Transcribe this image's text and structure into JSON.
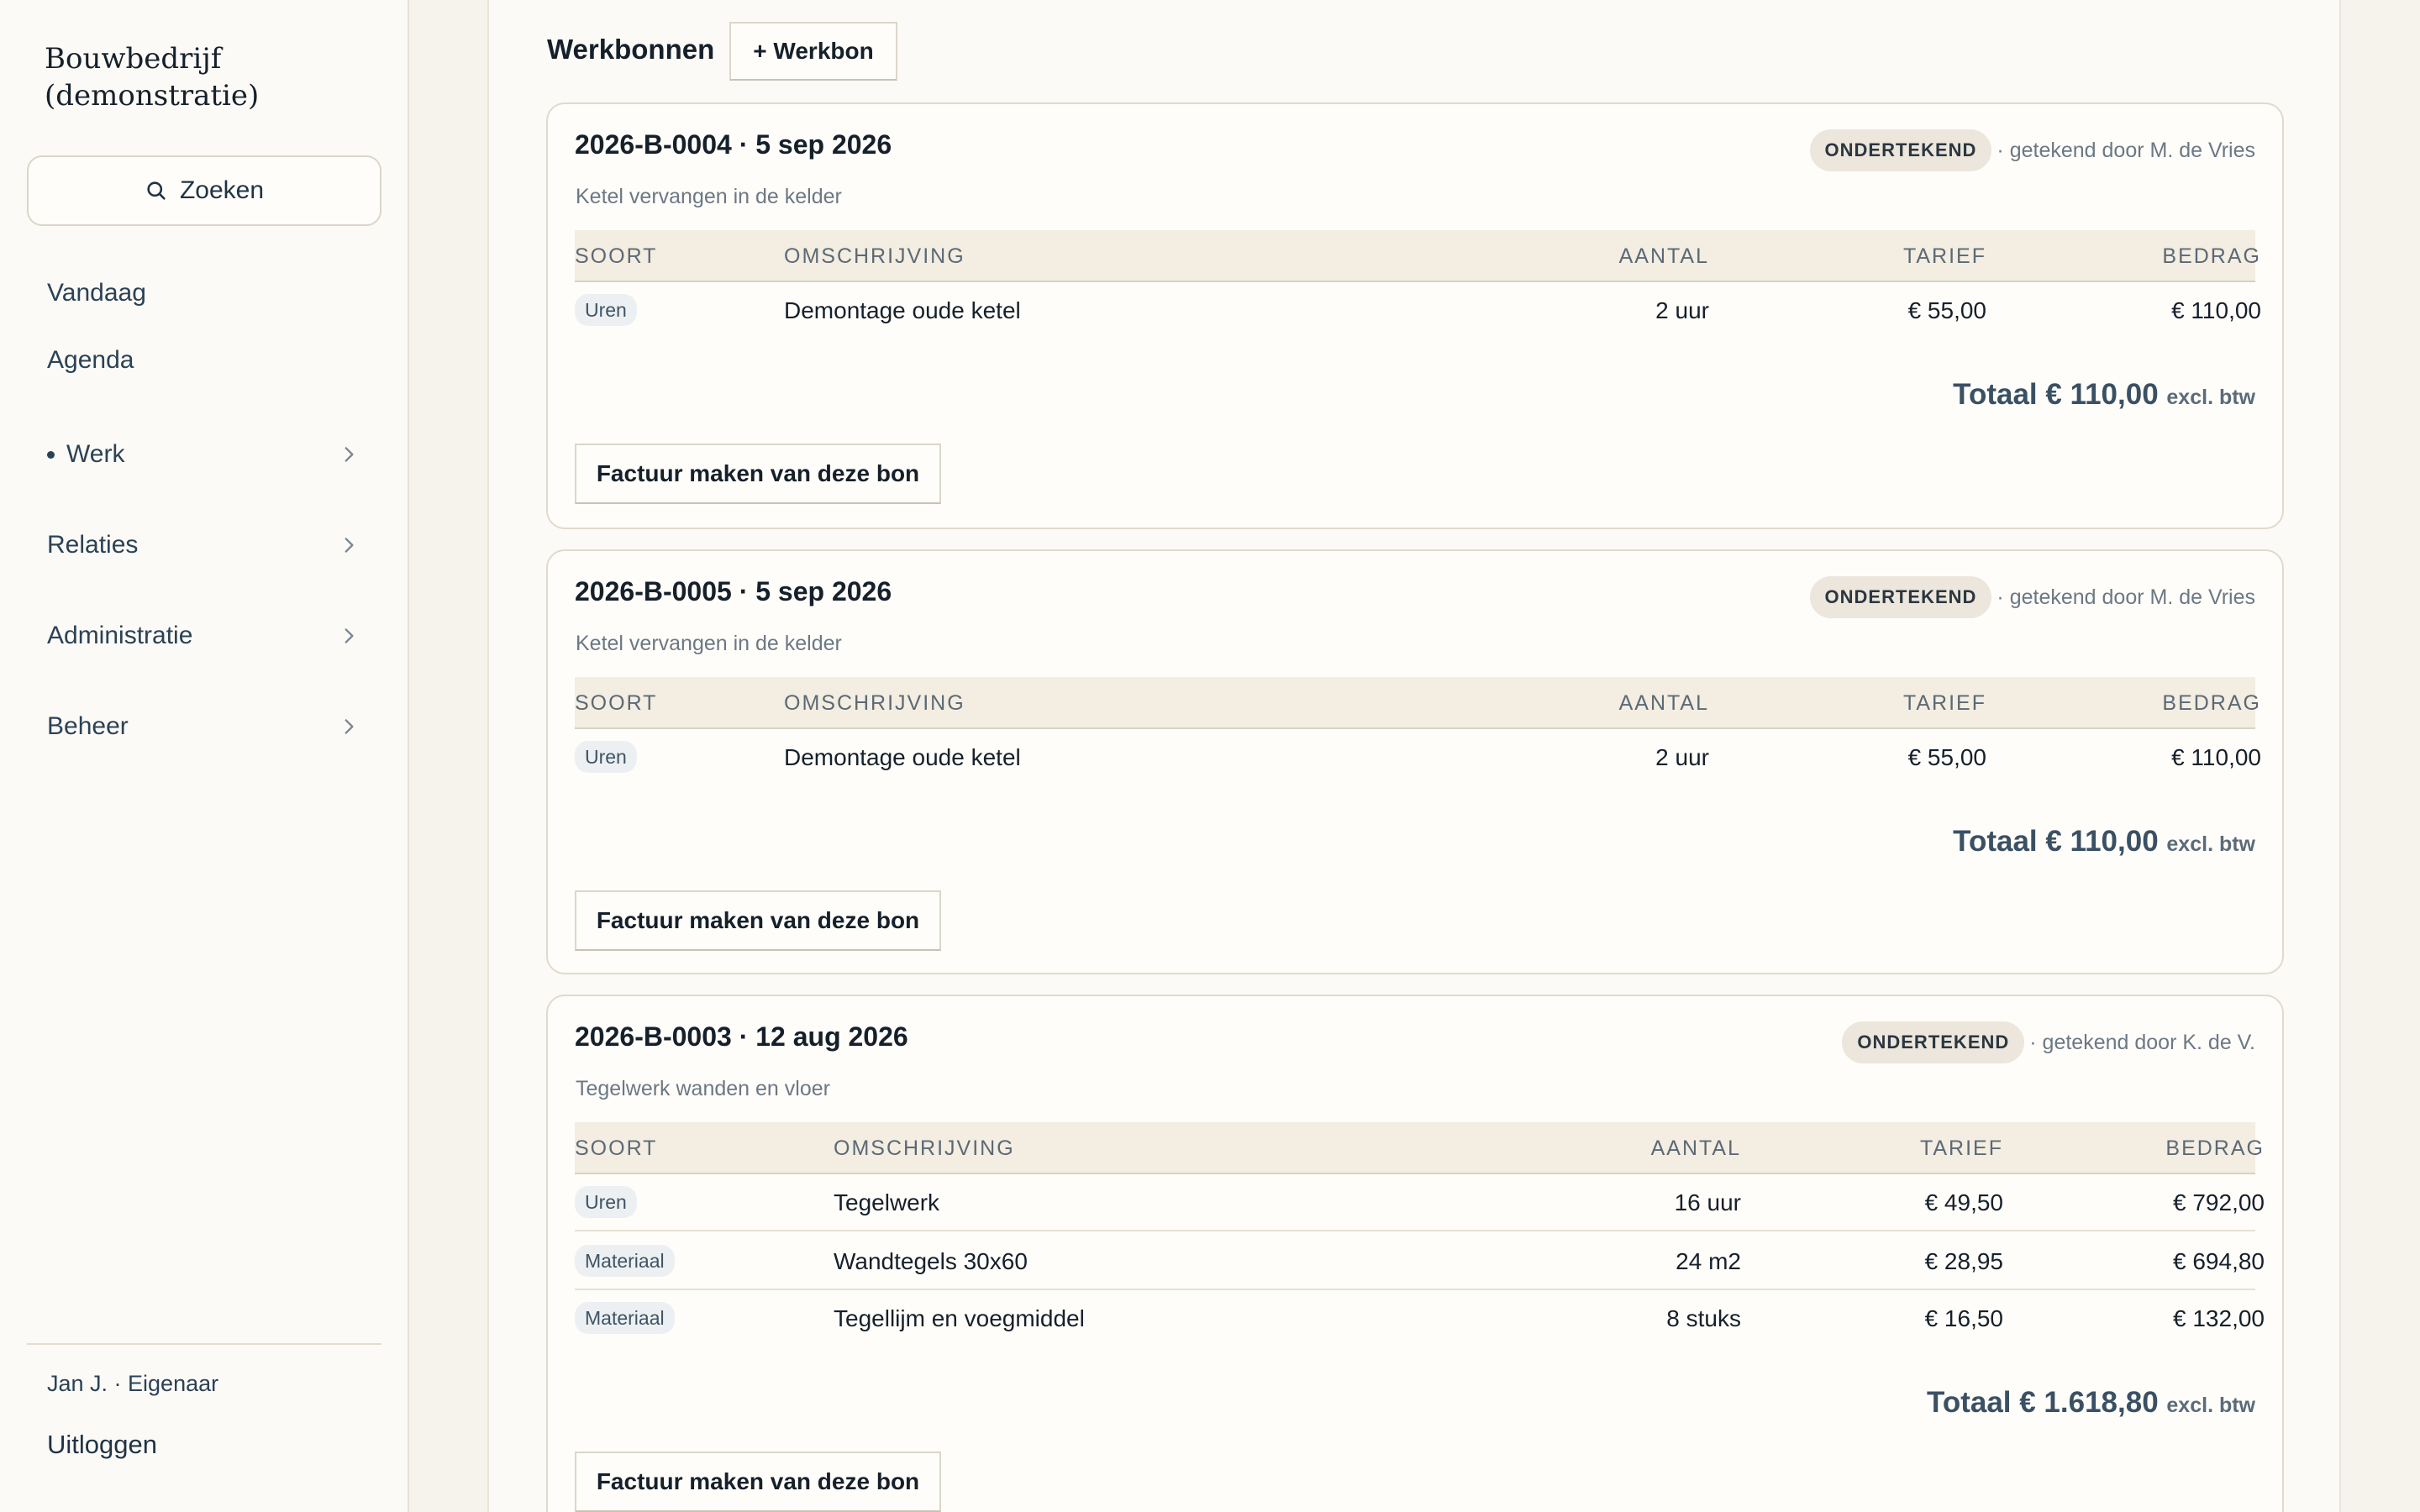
{
  "brand": {
    "line1": "Bouwbedrijf",
    "line2": "(demonstratie)"
  },
  "search": {
    "label": "Zoeken"
  },
  "nav": {
    "vandaag": "Vandaag",
    "agenda": "Agenda",
    "werk": "Werk",
    "relaties": "Relaties",
    "administratie": "Administratie",
    "beheer": "Beheer"
  },
  "user": {
    "name": "Jan J. · Eigenaar",
    "logout": "Uitloggen"
  },
  "werkbonnen": {
    "title": "Werkbonnen",
    "add_label": "+ Werkbon"
  },
  "headers": {
    "soort": "SOORT",
    "omschrijving": "OMSCHRIJVING",
    "aantal": "AANTAL",
    "tarief": "TARIEF",
    "bedrag": "BEDRAG"
  },
  "cards": [
    {
      "title": "2026-B-0004 · 5 sep 2026",
      "subtitle": "Ketel vervangen in de kelder",
      "status": "ONDERTEKEND",
      "signed_by": "· getekend door M. de Vries",
      "rows": [
        {
          "soort": "Uren",
          "omschrijving": "Demontage oude ketel",
          "aantal": "2 uur",
          "tarief": "€ 55,00",
          "bedrag": "€ 110,00"
        }
      ],
      "total": "Totaal € 110,00",
      "total_suffix": "excl. btw",
      "invoice_label": "Factuur maken van deze bon"
    },
    {
      "title": "2026-B-0005 · 5 sep 2026",
      "subtitle": "Ketel vervangen in de kelder",
      "status": "ONDERTEKEND",
      "signed_by": "· getekend door M. de Vries",
      "rows": [
        {
          "soort": "Uren",
          "omschrijving": "Demontage oude ketel",
          "aantal": "2 uur",
          "tarief": "€ 55,00",
          "bedrag": "€ 110,00"
        }
      ],
      "total": "Totaal € 110,00",
      "total_suffix": "excl. btw",
      "invoice_label": "Factuur maken van deze bon"
    },
    {
      "title": "2026-B-0003 · 12 aug 2026",
      "subtitle": "Tegelwerk wanden en vloer",
      "status": "ONDERTEKEND",
      "signed_by": "· getekend door K. de V.",
      "rows": [
        {
          "soort": "Uren",
          "omschrijving": "Tegelwerk",
          "aantal": "16 uur",
          "tarief": "€ 49,50",
          "bedrag": "€ 792,00"
        },
        {
          "soort": "Materiaal",
          "omschrijving": "Wandtegels 30x60",
          "aantal": "24 m2",
          "tarief": "€ 28,95",
          "bedrag": "€ 694,80"
        },
        {
          "soort": "Materiaal",
          "omschrijving": "Tegellijm en voegmiddel",
          "aantal": "8 stuks",
          "tarief": "€ 16,50",
          "bedrag": "€ 132,00"
        }
      ],
      "total": "Totaal € 1.618,80",
      "total_suffix": "excl. btw",
      "invoice_label": "Factuur maken van deze bon"
    }
  ]
}
